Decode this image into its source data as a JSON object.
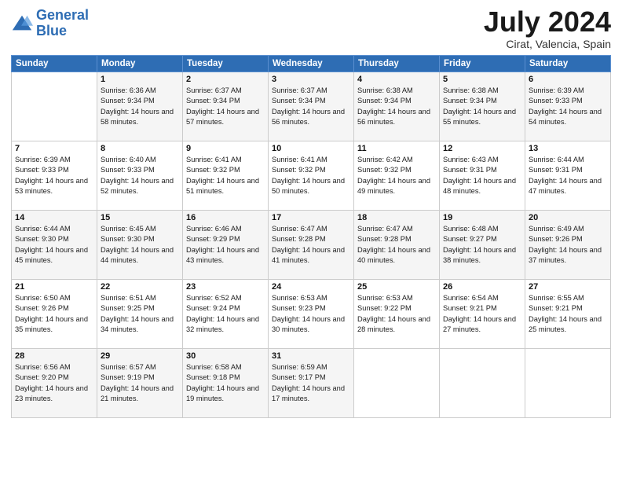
{
  "logo": {
    "line1": "General",
    "line2": "Blue"
  },
  "title": "July 2024",
  "location": "Cirat, Valencia, Spain",
  "days_header": [
    "Sunday",
    "Monday",
    "Tuesday",
    "Wednesday",
    "Thursday",
    "Friday",
    "Saturday"
  ],
  "weeks": [
    [
      {
        "day": "",
        "sunrise": "",
        "sunset": "",
        "daylight": ""
      },
      {
        "day": "1",
        "sunrise": "Sunrise: 6:36 AM",
        "sunset": "Sunset: 9:34 PM",
        "daylight": "Daylight: 14 hours and 58 minutes."
      },
      {
        "day": "2",
        "sunrise": "Sunrise: 6:37 AM",
        "sunset": "Sunset: 9:34 PM",
        "daylight": "Daylight: 14 hours and 57 minutes."
      },
      {
        "day": "3",
        "sunrise": "Sunrise: 6:37 AM",
        "sunset": "Sunset: 9:34 PM",
        "daylight": "Daylight: 14 hours and 56 minutes."
      },
      {
        "day": "4",
        "sunrise": "Sunrise: 6:38 AM",
        "sunset": "Sunset: 9:34 PM",
        "daylight": "Daylight: 14 hours and 56 minutes."
      },
      {
        "day": "5",
        "sunrise": "Sunrise: 6:38 AM",
        "sunset": "Sunset: 9:34 PM",
        "daylight": "Daylight: 14 hours and 55 minutes."
      },
      {
        "day": "6",
        "sunrise": "Sunrise: 6:39 AM",
        "sunset": "Sunset: 9:33 PM",
        "daylight": "Daylight: 14 hours and 54 minutes."
      }
    ],
    [
      {
        "day": "7",
        "sunrise": "Sunrise: 6:39 AM",
        "sunset": "Sunset: 9:33 PM",
        "daylight": "Daylight: 14 hours and 53 minutes."
      },
      {
        "day": "8",
        "sunrise": "Sunrise: 6:40 AM",
        "sunset": "Sunset: 9:33 PM",
        "daylight": "Daylight: 14 hours and 52 minutes."
      },
      {
        "day": "9",
        "sunrise": "Sunrise: 6:41 AM",
        "sunset": "Sunset: 9:32 PM",
        "daylight": "Daylight: 14 hours and 51 minutes."
      },
      {
        "day": "10",
        "sunrise": "Sunrise: 6:41 AM",
        "sunset": "Sunset: 9:32 PM",
        "daylight": "Daylight: 14 hours and 50 minutes."
      },
      {
        "day": "11",
        "sunrise": "Sunrise: 6:42 AM",
        "sunset": "Sunset: 9:32 PM",
        "daylight": "Daylight: 14 hours and 49 minutes."
      },
      {
        "day": "12",
        "sunrise": "Sunrise: 6:43 AM",
        "sunset": "Sunset: 9:31 PM",
        "daylight": "Daylight: 14 hours and 48 minutes."
      },
      {
        "day": "13",
        "sunrise": "Sunrise: 6:44 AM",
        "sunset": "Sunset: 9:31 PM",
        "daylight": "Daylight: 14 hours and 47 minutes."
      }
    ],
    [
      {
        "day": "14",
        "sunrise": "Sunrise: 6:44 AM",
        "sunset": "Sunset: 9:30 PM",
        "daylight": "Daylight: 14 hours and 45 minutes."
      },
      {
        "day": "15",
        "sunrise": "Sunrise: 6:45 AM",
        "sunset": "Sunset: 9:30 PM",
        "daylight": "Daylight: 14 hours and 44 minutes."
      },
      {
        "day": "16",
        "sunrise": "Sunrise: 6:46 AM",
        "sunset": "Sunset: 9:29 PM",
        "daylight": "Daylight: 14 hours and 43 minutes."
      },
      {
        "day": "17",
        "sunrise": "Sunrise: 6:47 AM",
        "sunset": "Sunset: 9:28 PM",
        "daylight": "Daylight: 14 hours and 41 minutes."
      },
      {
        "day": "18",
        "sunrise": "Sunrise: 6:47 AM",
        "sunset": "Sunset: 9:28 PM",
        "daylight": "Daylight: 14 hours and 40 minutes."
      },
      {
        "day": "19",
        "sunrise": "Sunrise: 6:48 AM",
        "sunset": "Sunset: 9:27 PM",
        "daylight": "Daylight: 14 hours and 38 minutes."
      },
      {
        "day": "20",
        "sunrise": "Sunrise: 6:49 AM",
        "sunset": "Sunset: 9:26 PM",
        "daylight": "Daylight: 14 hours and 37 minutes."
      }
    ],
    [
      {
        "day": "21",
        "sunrise": "Sunrise: 6:50 AM",
        "sunset": "Sunset: 9:26 PM",
        "daylight": "Daylight: 14 hours and 35 minutes."
      },
      {
        "day": "22",
        "sunrise": "Sunrise: 6:51 AM",
        "sunset": "Sunset: 9:25 PM",
        "daylight": "Daylight: 14 hours and 34 minutes."
      },
      {
        "day": "23",
        "sunrise": "Sunrise: 6:52 AM",
        "sunset": "Sunset: 9:24 PM",
        "daylight": "Daylight: 14 hours and 32 minutes."
      },
      {
        "day": "24",
        "sunrise": "Sunrise: 6:53 AM",
        "sunset": "Sunset: 9:23 PM",
        "daylight": "Daylight: 14 hours and 30 minutes."
      },
      {
        "day": "25",
        "sunrise": "Sunrise: 6:53 AM",
        "sunset": "Sunset: 9:22 PM",
        "daylight": "Daylight: 14 hours and 28 minutes."
      },
      {
        "day": "26",
        "sunrise": "Sunrise: 6:54 AM",
        "sunset": "Sunset: 9:21 PM",
        "daylight": "Daylight: 14 hours and 27 minutes."
      },
      {
        "day": "27",
        "sunrise": "Sunrise: 6:55 AM",
        "sunset": "Sunset: 9:21 PM",
        "daylight": "Daylight: 14 hours and 25 minutes."
      }
    ],
    [
      {
        "day": "28",
        "sunrise": "Sunrise: 6:56 AM",
        "sunset": "Sunset: 9:20 PM",
        "daylight": "Daylight: 14 hours and 23 minutes."
      },
      {
        "day": "29",
        "sunrise": "Sunrise: 6:57 AM",
        "sunset": "Sunset: 9:19 PM",
        "daylight": "Daylight: 14 hours and 21 minutes."
      },
      {
        "day": "30",
        "sunrise": "Sunrise: 6:58 AM",
        "sunset": "Sunset: 9:18 PM",
        "daylight": "Daylight: 14 hours and 19 minutes."
      },
      {
        "day": "31",
        "sunrise": "Sunrise: 6:59 AM",
        "sunset": "Sunset: 9:17 PM",
        "daylight": "Daylight: 14 hours and 17 minutes."
      },
      {
        "day": "",
        "sunrise": "",
        "sunset": "",
        "daylight": ""
      },
      {
        "day": "",
        "sunrise": "",
        "sunset": "",
        "daylight": ""
      },
      {
        "day": "",
        "sunrise": "",
        "sunset": "",
        "daylight": ""
      }
    ]
  ]
}
